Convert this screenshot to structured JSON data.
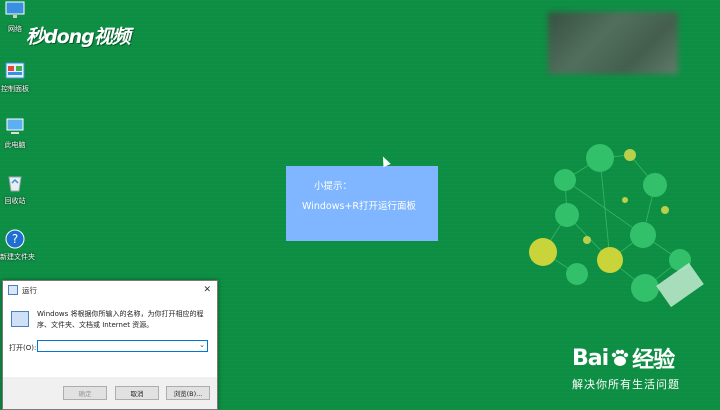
{
  "desktop": {
    "icons": [
      {
        "label": "网络",
        "icon": "network-icon"
      },
      {
        "label": "控制面板",
        "icon": "control-panel-icon"
      },
      {
        "label": "此电脑",
        "icon": "this-pc-icon"
      },
      {
        "label": "回收站",
        "icon": "recycle-bin-icon"
      },
      {
        "label": "新建文件夹",
        "icon": "help-icon"
      }
    ]
  },
  "watermark": {
    "brand": "秒dong视频"
  },
  "tip": {
    "line1": "小提示：",
    "line2": "Windows+R打开运行面板"
  },
  "run_dialog": {
    "title": "运行",
    "description": "Windows 将根据你所输入的名称，为你打开相应的程序、文件夹、文档或 Internet 资源。",
    "open_label": "打开(O):",
    "open_value": "",
    "ok_label": "确定",
    "cancel_label": "取消",
    "browse_label": "浏览(B)..."
  },
  "baidu": {
    "logo_left": "Bai",
    "logo_right": "经验",
    "tagline": "解决你所有生活问题"
  },
  "colors": {
    "desktop": "#0f8f43",
    "tip": "#7fb6ff",
    "accent": "#0078d7"
  }
}
